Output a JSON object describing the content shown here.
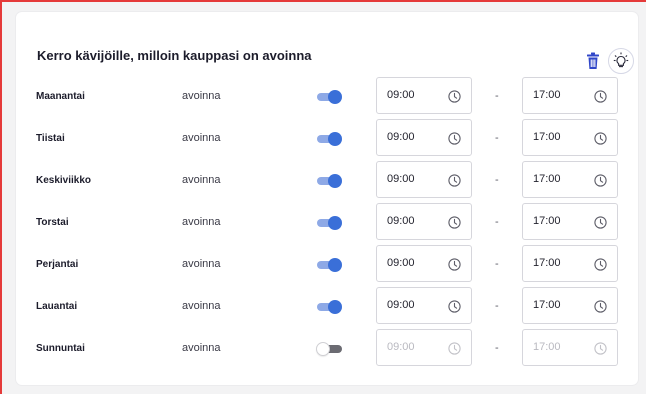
{
  "card": {
    "title": "Kerro kävijöille, milloin kauppasi on avoinna"
  },
  "icons": {
    "trash": "trash-icon",
    "bulb": "lightbulb-icon",
    "clock": "clock-icon"
  },
  "colors": {
    "accent": "#3a6fd8",
    "trash": "#3046c8",
    "frame": "#e53a3a"
  },
  "separator": "-",
  "days": [
    {
      "label": "Maanantai",
      "status": "avoinna",
      "open": true,
      "start": "09:00",
      "end": "17:00"
    },
    {
      "label": "Tiistai",
      "status": "avoinna",
      "open": true,
      "start": "09:00",
      "end": "17:00"
    },
    {
      "label": "Keskiviikko",
      "status": "avoinna",
      "open": true,
      "start": "09:00",
      "end": "17:00"
    },
    {
      "label": "Torstai",
      "status": "avoinna",
      "open": true,
      "start": "09:00",
      "end": "17:00"
    },
    {
      "label": "Perjantai",
      "status": "avoinna",
      "open": true,
      "start": "09:00",
      "end": "17:00"
    },
    {
      "label": "Lauantai",
      "status": "avoinna",
      "open": true,
      "start": "09:00",
      "end": "17:00"
    },
    {
      "label": "Sunnuntai",
      "status": "avoinna",
      "open": false,
      "start": "09:00",
      "end": "17:00"
    }
  ]
}
